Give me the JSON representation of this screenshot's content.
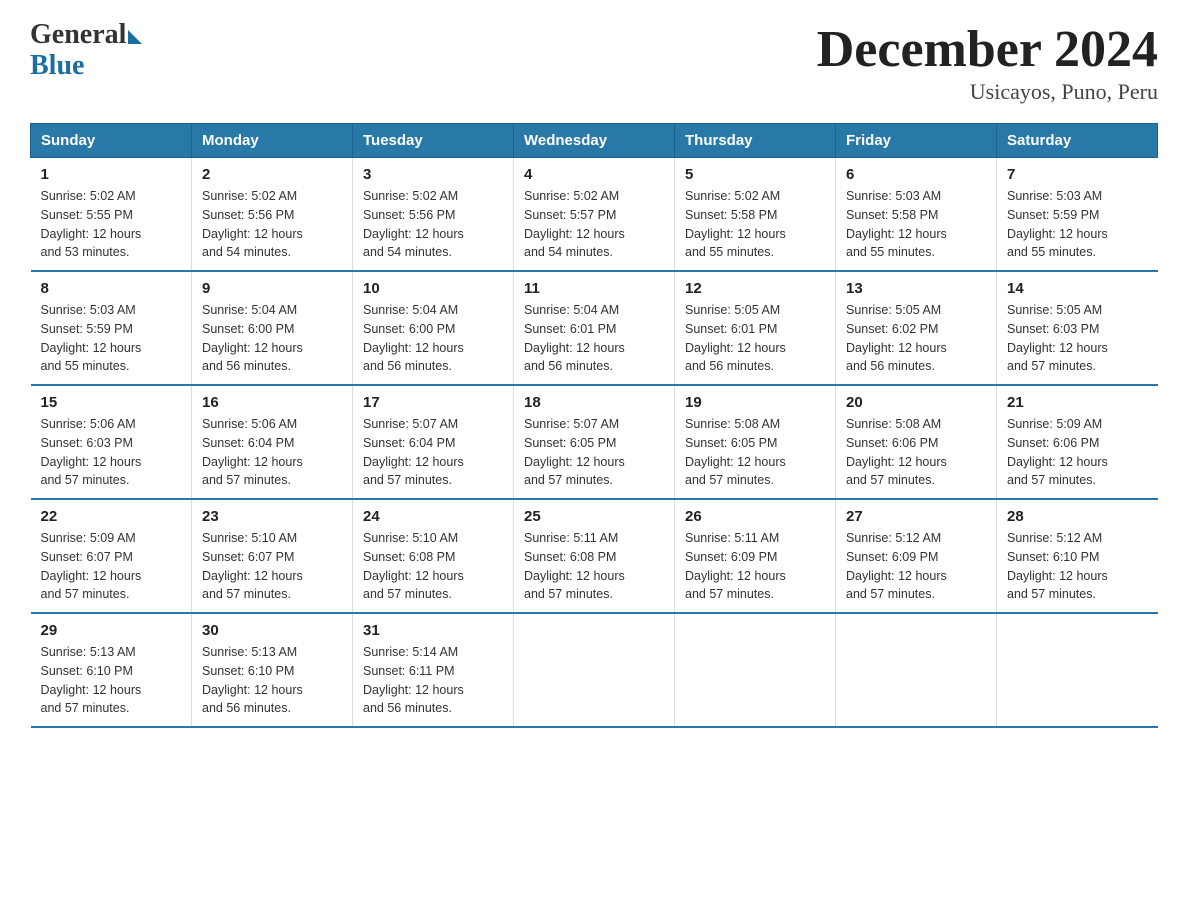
{
  "header": {
    "logo_general": "General",
    "logo_blue": "Blue",
    "title": "December 2024",
    "subtitle": "Usicayos, Puno, Peru"
  },
  "days_of_week": [
    "Sunday",
    "Monday",
    "Tuesday",
    "Wednesday",
    "Thursday",
    "Friday",
    "Saturday"
  ],
  "weeks": [
    [
      {
        "num": "1",
        "sunrise": "5:02 AM",
        "sunset": "5:55 PM",
        "daylight": "12 hours and 53 minutes."
      },
      {
        "num": "2",
        "sunrise": "5:02 AM",
        "sunset": "5:56 PM",
        "daylight": "12 hours and 54 minutes."
      },
      {
        "num": "3",
        "sunrise": "5:02 AM",
        "sunset": "5:56 PM",
        "daylight": "12 hours and 54 minutes."
      },
      {
        "num": "4",
        "sunrise": "5:02 AM",
        "sunset": "5:57 PM",
        "daylight": "12 hours and 54 minutes."
      },
      {
        "num": "5",
        "sunrise": "5:02 AM",
        "sunset": "5:58 PM",
        "daylight": "12 hours and 55 minutes."
      },
      {
        "num": "6",
        "sunrise": "5:03 AM",
        "sunset": "5:58 PM",
        "daylight": "12 hours and 55 minutes."
      },
      {
        "num": "7",
        "sunrise": "5:03 AM",
        "sunset": "5:59 PM",
        "daylight": "12 hours and 55 minutes."
      }
    ],
    [
      {
        "num": "8",
        "sunrise": "5:03 AM",
        "sunset": "5:59 PM",
        "daylight": "12 hours and 55 minutes."
      },
      {
        "num": "9",
        "sunrise": "5:04 AM",
        "sunset": "6:00 PM",
        "daylight": "12 hours and 56 minutes."
      },
      {
        "num": "10",
        "sunrise": "5:04 AM",
        "sunset": "6:00 PM",
        "daylight": "12 hours and 56 minutes."
      },
      {
        "num": "11",
        "sunrise": "5:04 AM",
        "sunset": "6:01 PM",
        "daylight": "12 hours and 56 minutes."
      },
      {
        "num": "12",
        "sunrise": "5:05 AM",
        "sunset": "6:01 PM",
        "daylight": "12 hours and 56 minutes."
      },
      {
        "num": "13",
        "sunrise": "5:05 AM",
        "sunset": "6:02 PM",
        "daylight": "12 hours and 56 minutes."
      },
      {
        "num": "14",
        "sunrise": "5:05 AM",
        "sunset": "6:03 PM",
        "daylight": "12 hours and 57 minutes."
      }
    ],
    [
      {
        "num": "15",
        "sunrise": "5:06 AM",
        "sunset": "6:03 PM",
        "daylight": "12 hours and 57 minutes."
      },
      {
        "num": "16",
        "sunrise": "5:06 AM",
        "sunset": "6:04 PM",
        "daylight": "12 hours and 57 minutes."
      },
      {
        "num": "17",
        "sunrise": "5:07 AM",
        "sunset": "6:04 PM",
        "daylight": "12 hours and 57 minutes."
      },
      {
        "num": "18",
        "sunrise": "5:07 AM",
        "sunset": "6:05 PM",
        "daylight": "12 hours and 57 minutes."
      },
      {
        "num": "19",
        "sunrise": "5:08 AM",
        "sunset": "6:05 PM",
        "daylight": "12 hours and 57 minutes."
      },
      {
        "num": "20",
        "sunrise": "5:08 AM",
        "sunset": "6:06 PM",
        "daylight": "12 hours and 57 minutes."
      },
      {
        "num": "21",
        "sunrise": "5:09 AM",
        "sunset": "6:06 PM",
        "daylight": "12 hours and 57 minutes."
      }
    ],
    [
      {
        "num": "22",
        "sunrise": "5:09 AM",
        "sunset": "6:07 PM",
        "daylight": "12 hours and 57 minutes."
      },
      {
        "num": "23",
        "sunrise": "5:10 AM",
        "sunset": "6:07 PM",
        "daylight": "12 hours and 57 minutes."
      },
      {
        "num": "24",
        "sunrise": "5:10 AM",
        "sunset": "6:08 PM",
        "daylight": "12 hours and 57 minutes."
      },
      {
        "num": "25",
        "sunrise": "5:11 AM",
        "sunset": "6:08 PM",
        "daylight": "12 hours and 57 minutes."
      },
      {
        "num": "26",
        "sunrise": "5:11 AM",
        "sunset": "6:09 PM",
        "daylight": "12 hours and 57 minutes."
      },
      {
        "num": "27",
        "sunrise": "5:12 AM",
        "sunset": "6:09 PM",
        "daylight": "12 hours and 57 minutes."
      },
      {
        "num": "28",
        "sunrise": "5:12 AM",
        "sunset": "6:10 PM",
        "daylight": "12 hours and 57 minutes."
      }
    ],
    [
      {
        "num": "29",
        "sunrise": "5:13 AM",
        "sunset": "6:10 PM",
        "daylight": "12 hours and 57 minutes."
      },
      {
        "num": "30",
        "sunrise": "5:13 AM",
        "sunset": "6:10 PM",
        "daylight": "12 hours and 56 minutes."
      },
      {
        "num": "31",
        "sunrise": "5:14 AM",
        "sunset": "6:11 PM",
        "daylight": "12 hours and 56 minutes."
      },
      null,
      null,
      null,
      null
    ]
  ],
  "labels": {
    "sunrise": "Sunrise:",
    "sunset": "Sunset:",
    "daylight": "Daylight:"
  }
}
